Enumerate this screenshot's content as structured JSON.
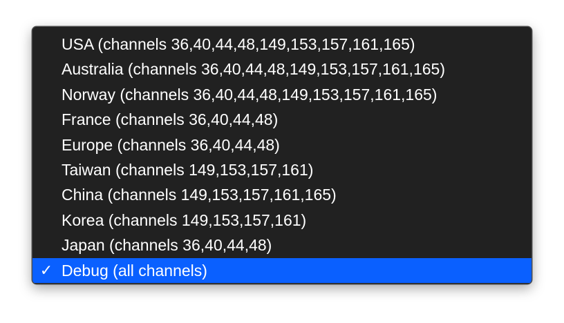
{
  "menu": {
    "items": [
      {
        "label": "USA (channels 36,40,44,48,149,153,157,161,165)",
        "selected": false
      },
      {
        "label": "Australia (channels 36,40,44,48,149,153,157,161,165)",
        "selected": false
      },
      {
        "label": "Norway (channels 36,40,44,48,149,153,157,161,165)",
        "selected": false
      },
      {
        "label": "France (channels 36,40,44,48)",
        "selected": false
      },
      {
        "label": "Europe (channels 36,40,44,48)",
        "selected": false
      },
      {
        "label": "Taiwan (channels 149,153,157,161)",
        "selected": false
      },
      {
        "label": "China (channels 149,153,157,161,165)",
        "selected": false
      },
      {
        "label": "Korea (channels 149,153,157,161)",
        "selected": false
      },
      {
        "label": "Japan (channels 36,40,44,48)",
        "selected": false
      },
      {
        "label": "Debug (all channels)",
        "selected": true
      }
    ],
    "checkmark_glyph": "✓",
    "colors": {
      "menu_background": "#212121",
      "selection_highlight": "#0a60ff",
      "text": "#ffffff"
    }
  }
}
